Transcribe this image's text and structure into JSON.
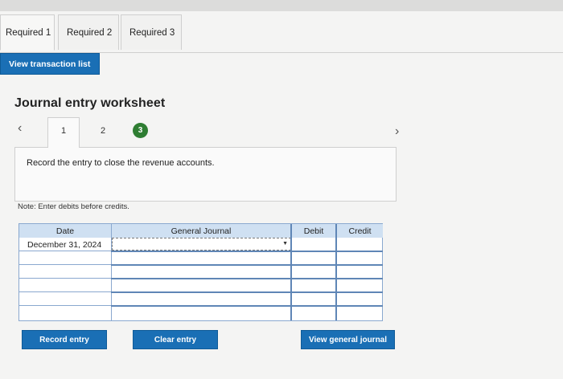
{
  "tabs": [
    {
      "label": "Required 1"
    },
    {
      "label": "Required 2"
    },
    {
      "label": "Required 3"
    }
  ],
  "view_transaction_list": "View transaction list",
  "worksheet": {
    "title": "Journal entry worksheet",
    "steps": [
      "1",
      "2",
      "3"
    ],
    "instruction": "Record the entry to close the revenue accounts.",
    "note": "Note: Enter debits before credits."
  },
  "table": {
    "headers": {
      "date": "Date",
      "general_journal": "General Journal",
      "debit": "Debit",
      "credit": "Credit"
    },
    "rows": [
      {
        "date": "December 31, 2024",
        "account": "",
        "debit": "",
        "credit": ""
      },
      {
        "date": "",
        "account": "",
        "debit": "",
        "credit": ""
      },
      {
        "date": "",
        "account": "",
        "debit": "",
        "credit": ""
      },
      {
        "date": "",
        "account": "",
        "debit": "",
        "credit": ""
      },
      {
        "date": "",
        "account": "",
        "debit": "",
        "credit": ""
      },
      {
        "date": "",
        "account": "",
        "debit": "",
        "credit": ""
      }
    ]
  },
  "buttons": {
    "record": "Record entry",
    "clear": "Clear entry",
    "view_general_journal": "View general journal"
  },
  "colors": {
    "accent": "#1a6fb5",
    "header": "#cfe0f2",
    "completed_step": "#2e7d32"
  }
}
